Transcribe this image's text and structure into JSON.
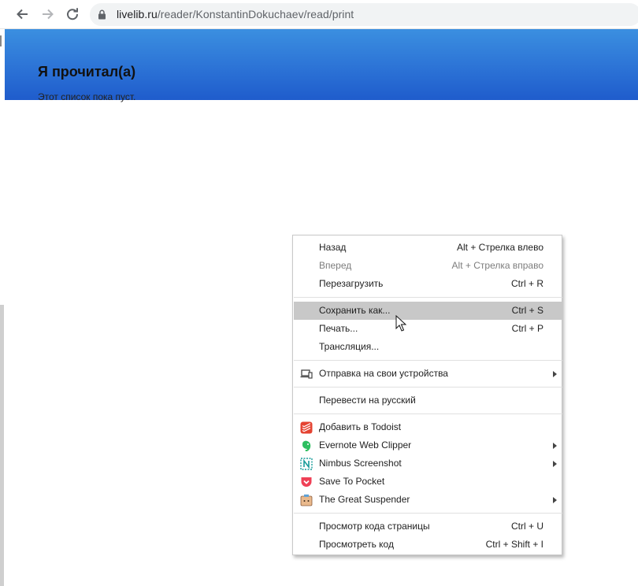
{
  "browser": {
    "url_host": "livelib.ru",
    "url_path": "/reader/KonstantinDokuchaev/read/print"
  },
  "page": {
    "title": "Я прочитал(а)",
    "empty_text": "Этот список пока пуст."
  },
  "menu": {
    "back": {
      "label": "Назад",
      "shortcut": "Alt + Стрелка влево"
    },
    "forward": {
      "label": "Вперед",
      "shortcut": "Alt + Стрелка вправо"
    },
    "reload": {
      "label": "Перезагрузить",
      "shortcut": "Ctrl + R"
    },
    "save_as": {
      "label": "Сохранить как...",
      "shortcut": "Ctrl + S"
    },
    "print": {
      "label": "Печать...",
      "shortcut": "Ctrl + P"
    },
    "cast": {
      "label": "Трансляция..."
    },
    "send_to_devices": {
      "label": "Отправка на свои устройства"
    },
    "translate": {
      "label": "Перевести на русский"
    },
    "todoist": {
      "label": "Добавить в Todoist"
    },
    "evernote": {
      "label": "Evernote Web Clipper"
    },
    "nimbus": {
      "label": "Nimbus Screenshot"
    },
    "pocket": {
      "label": "Save To Pocket"
    },
    "suspender": {
      "label": "The Great Suspender"
    },
    "view_source": {
      "label": "Просмотр кода страницы",
      "shortcut": "Ctrl + U"
    },
    "inspect": {
      "label": "Просмотреть код",
      "shortcut": "Ctrl + Shift + I"
    }
  },
  "colors": {
    "banner_top": "#3b8fe0",
    "banner_bottom": "#1f5ccc",
    "menu_highlight": "#c8c8c8",
    "todoist": "#e44332",
    "evernote": "#2dbe60",
    "nimbus": "#1a9c9a",
    "pocket": "#ef4056"
  },
  "icons": [
    "back-arrow-icon",
    "forward-arrow-icon",
    "reload-icon",
    "lock-icon",
    "devices-icon",
    "todoist-icon",
    "evernote-icon",
    "nimbus-icon",
    "pocket-icon",
    "suspender-icon",
    "submenu-arrow-icon",
    "mouse-cursor-icon"
  ]
}
